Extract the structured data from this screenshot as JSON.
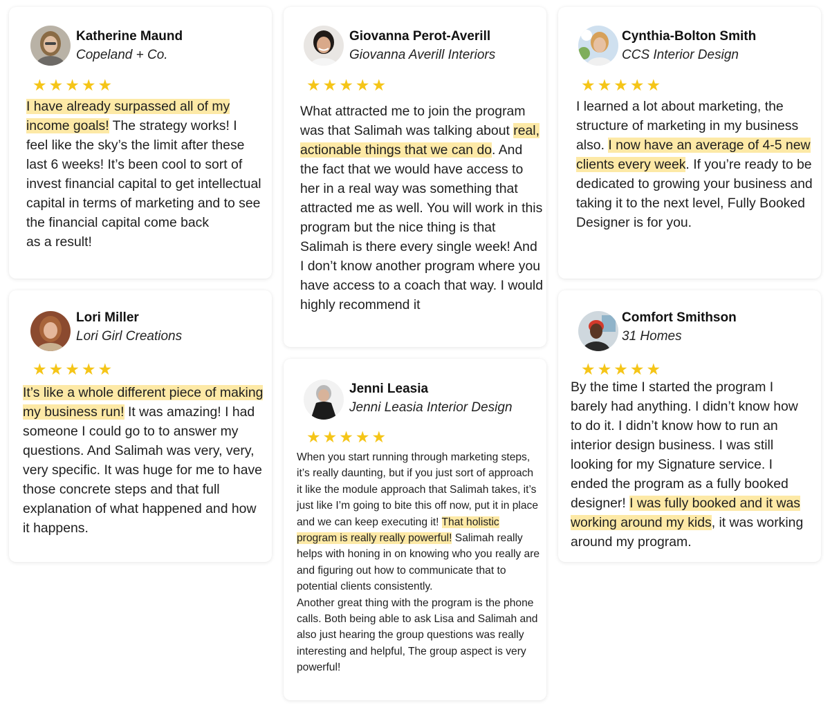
{
  "rating_stars": "★★★★★",
  "highlight_color": "#fde9a6",
  "star_color": "#f5c518",
  "testimonials": {
    "katherine": {
      "name": "Katherine Maund",
      "company": "Copeland + Co.",
      "highlight": "I have already surpassed all of my income goals!",
      "text": " The strategy works! I feel like the sky’s the limit after these last 6 weeks! It’s been cool to sort of invest financial capital to get intellectual capital in terms of marketing and to see the financial capital come back",
      "text_end": "as a result!"
    },
    "giovanna": {
      "name": "Giovanna Perot-Averill",
      "company": "Giovanna Averill Interiors",
      "text_before": "What attracted me to join the program was that Salimah was talking about ",
      "highlight": "real, actionable things that we can do",
      "text_after": ". And the fact that we would have access to her in a real way was something that attracted me as well. You will work in this program but the nice thing is that Salimah is there every single week! And I don’t know another program where you have access to a coach that way. I would highly recommend it"
    },
    "cynthia": {
      "name": "Cynthia-Bolton Smith",
      "company": "CCS Interior Design",
      "text_before": "I learned a lot about marketing, the structure of marketing in my business also. ",
      "highlight": "I now have an average of 4-5 new clients every week",
      "text_after": ". If you’re ready to be dedicated to growing your business and taking it to the next level, Fully Booked Designer is for you."
    },
    "lori": {
      "name": "Lori Miller",
      "company": "Lori Girl Creations",
      "highlight": "It’s like a whole different piece of making my business run!",
      "text_after": " It was amazing! I had someone I could go to to answer my questions. And Salimah was very, very, very specific. It was huge for me to have those concrete steps and that full explanation of what happened and how it happens."
    },
    "jenni": {
      "name": "Jenni Leasia",
      "company": "Jenni Leasia Interior Design",
      "text_before": "When you start running through marketing steps, it’s really daunting, but if you just sort of approach it like the module approach that Salimah takes, it’s just like I’m going to bite this off now, put it in place and we can keep executing it! ",
      "highlight": "That holistic program is really really powerful!",
      "text_after": " Salimah really helps with honing in on knowing who you really are and figuring out how to communicate that to potential clients consistently.",
      "text_end": "Another great thing with the program is the phone calls. Both being able to ask Lisa and Salimah and also just hearing the group questions was really interesting and helpful, The group aspect is very powerful!"
    },
    "comfort": {
      "name": "Comfort Smithson",
      "company": "31 Homes",
      "text_before": "By the time I started the program I barely had anything. I didn’t know how to do it. I didn’t know how to run an interior design business. I was still looking for my Signature service. I ended the program as a fully booked designer! ",
      "highlight": "I was fully booked and it was working around my kids",
      "text_after": ", it was working around my program."
    }
  }
}
